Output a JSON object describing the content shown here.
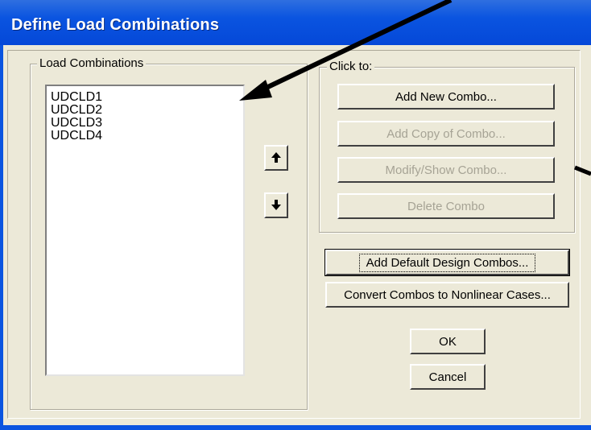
{
  "window": {
    "title": "Define Load Combinations"
  },
  "load_combinations": {
    "group_label": "Load Combinations",
    "items": [
      "UDCLD1",
      "UDCLD2",
      "UDCLD3",
      "UDCLD4"
    ]
  },
  "click_to": {
    "group_label": "Click to:",
    "add_new_combo": "Add New Combo...",
    "add_copy_of_combo": "Add Copy of Combo...",
    "modify_show_combo": "Modify/Show Combo...",
    "delete_combo": "Delete Combo"
  },
  "actions": {
    "add_default_design_combos": "Add Default Design Combos...",
    "convert_combos": "Convert Combos to Nonlinear Cases...",
    "ok": "OK",
    "cancel": "Cancel"
  },
  "icons": {
    "move_up": "arrow-up-icon",
    "move_down": "arrow-down-icon"
  },
  "colors": {
    "titlebar": "#0a54e0",
    "dialog_bg": "#ece9d8",
    "disabled_text": "#a6a395"
  }
}
